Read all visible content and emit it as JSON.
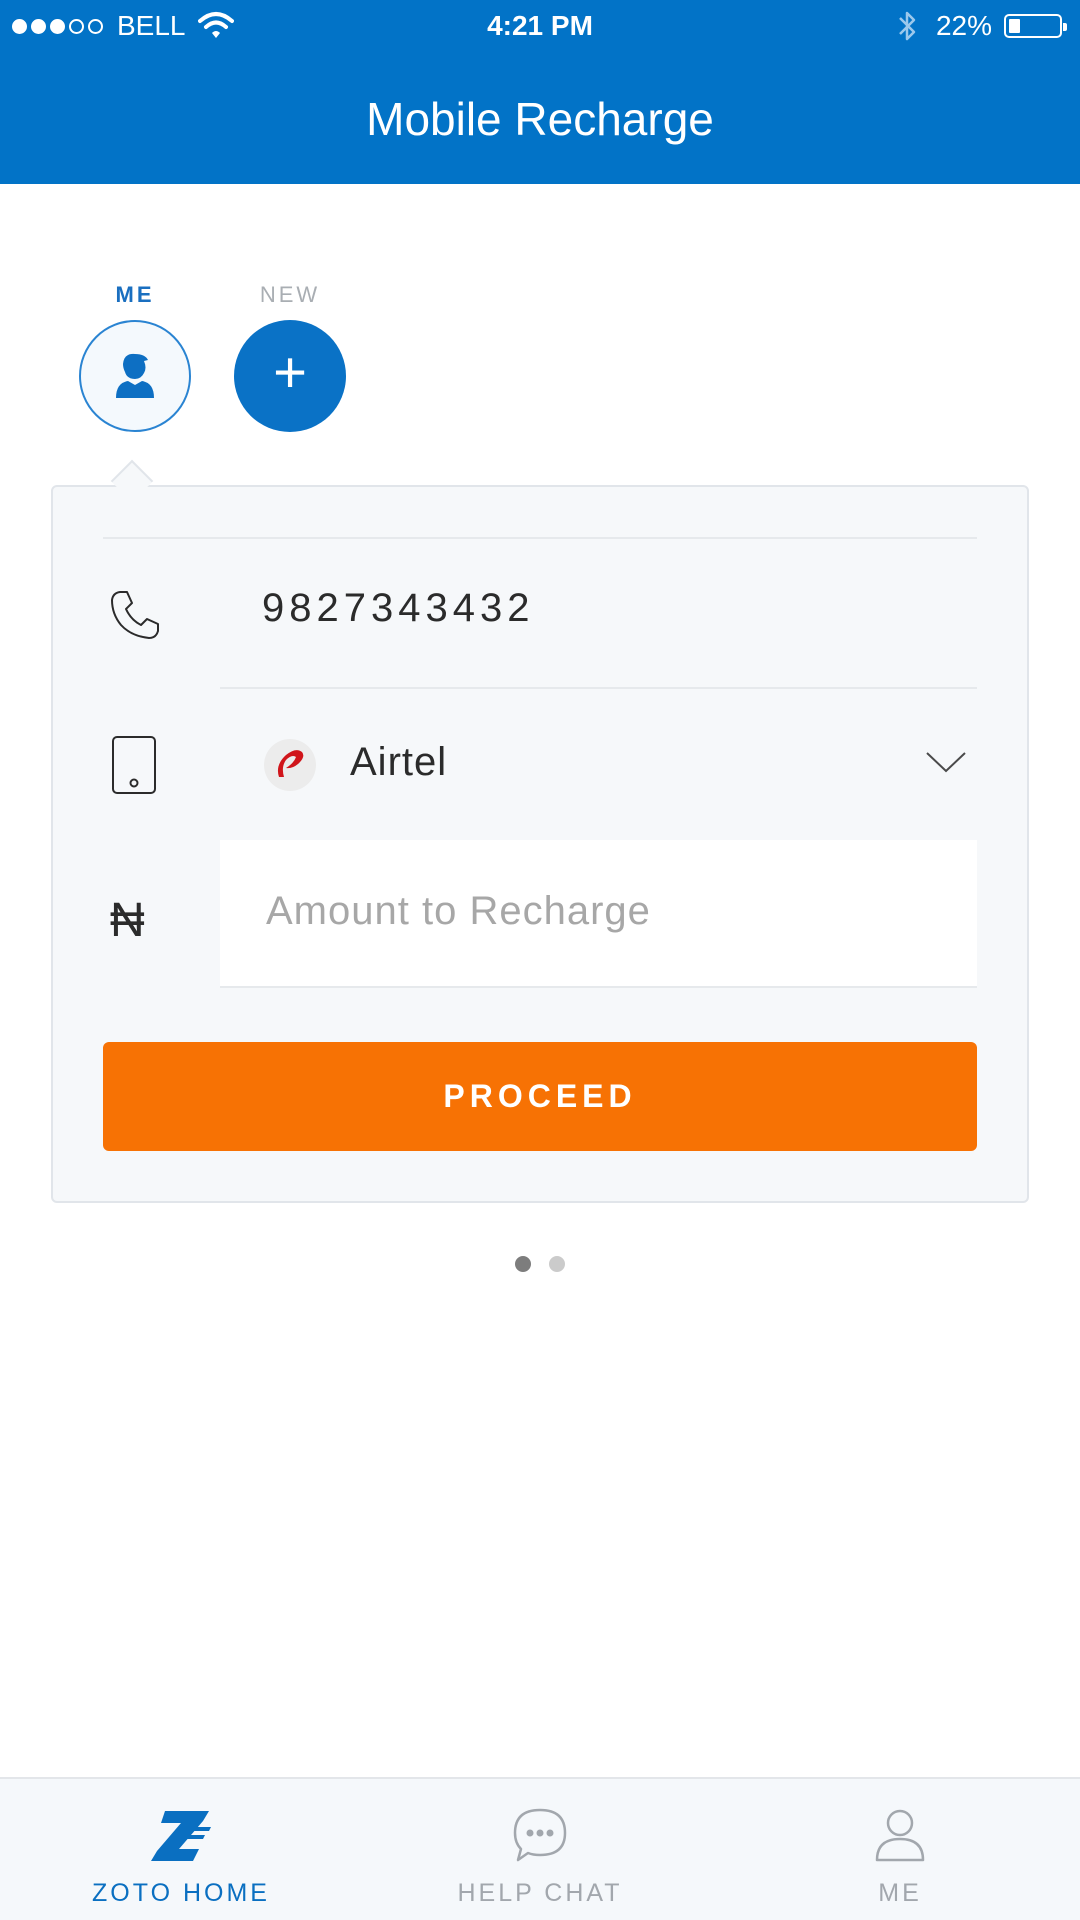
{
  "status_bar": {
    "carrier": "BELL",
    "signal_bars_filled": 3,
    "signal_bars_total": 5,
    "time": "4:21 PM",
    "battery_percent": "22%",
    "battery_level": 0.22
  },
  "header": {
    "title": "Mobile Recharge"
  },
  "contacts": [
    {
      "label": "ME",
      "icon": "user-icon",
      "selected": true
    },
    {
      "label": "NEW",
      "icon": "plus-icon",
      "symbol": "+"
    }
  ],
  "form": {
    "phone_number": "9827343432",
    "operator": "Airtel",
    "amount": {
      "value": "",
      "placeholder": "Amount to Recharge"
    },
    "currency_symbol": "₦",
    "proceed_label": "PROCEED"
  },
  "pager": {
    "count": 2,
    "active_index": 0
  },
  "tabs": [
    {
      "label": "ZOTO HOME",
      "icon": "zoto-logo-icon",
      "active": true
    },
    {
      "label": "HELP CHAT",
      "icon": "chat-bubble-icon",
      "active": false
    },
    {
      "label": "ME",
      "icon": "profile-icon",
      "active": false
    }
  ],
  "colors": {
    "header_blue": "#0273c7",
    "accent_orange": "#f77204",
    "card_bg": "#f6f8fa",
    "airtel_red": "#d0151b"
  }
}
